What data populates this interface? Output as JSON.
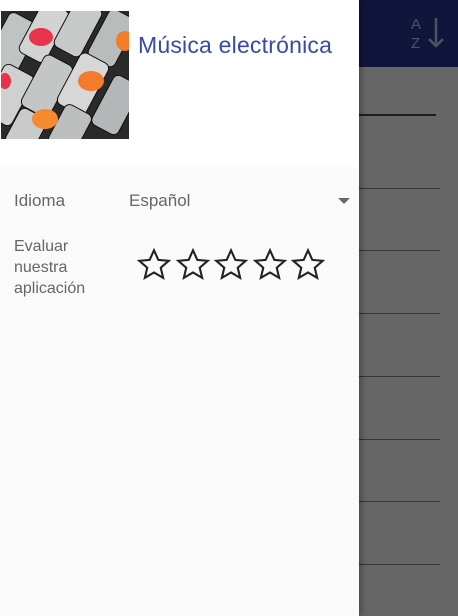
{
  "drawer": {
    "header": {
      "title": "Música electrónica",
      "image_description_icon": "mixer-knobs-image"
    },
    "settings": {
      "language_label": "Idioma",
      "language_value": "Español",
      "rate_label": "Evaluar nuestra aplicación",
      "rating": {
        "value": 0,
        "max": 5
      }
    }
  },
  "app_bar": {
    "color": "#283593",
    "sort_icon": "sort-alpha-icon"
  },
  "colors": {
    "accent": "#3949ab",
    "drawer_bg": "#fafafa"
  }
}
